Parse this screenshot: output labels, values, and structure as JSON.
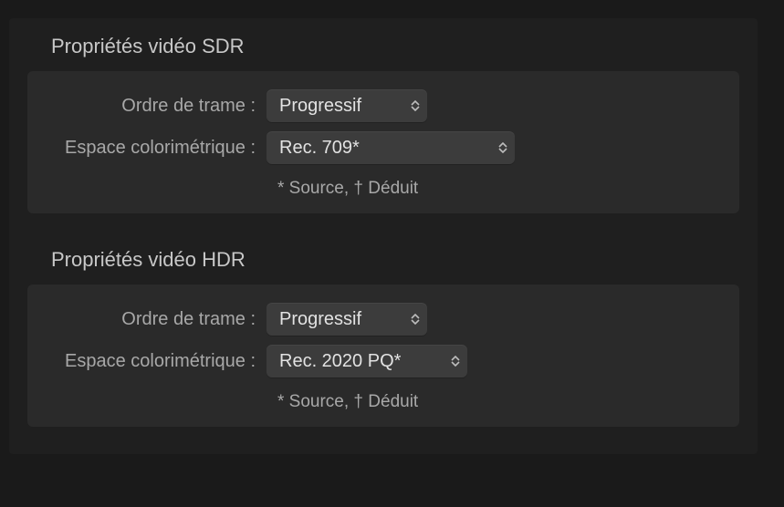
{
  "sdr": {
    "title": "Propriétés vidéo SDR",
    "field_order_label": "Ordre de trame :",
    "field_order_value": "Progressif",
    "colorspace_label": "Espace colorimétrique :",
    "colorspace_value": "Rec. 709*",
    "legend": "* Source, † Déduit"
  },
  "hdr": {
    "title": "Propriétés vidéo HDR",
    "field_order_label": "Ordre de trame :",
    "field_order_value": "Progressif",
    "colorspace_label": "Espace colorimétrique :",
    "colorspace_value": "Rec. 2020 PQ*",
    "legend": "* Source, † Déduit"
  }
}
